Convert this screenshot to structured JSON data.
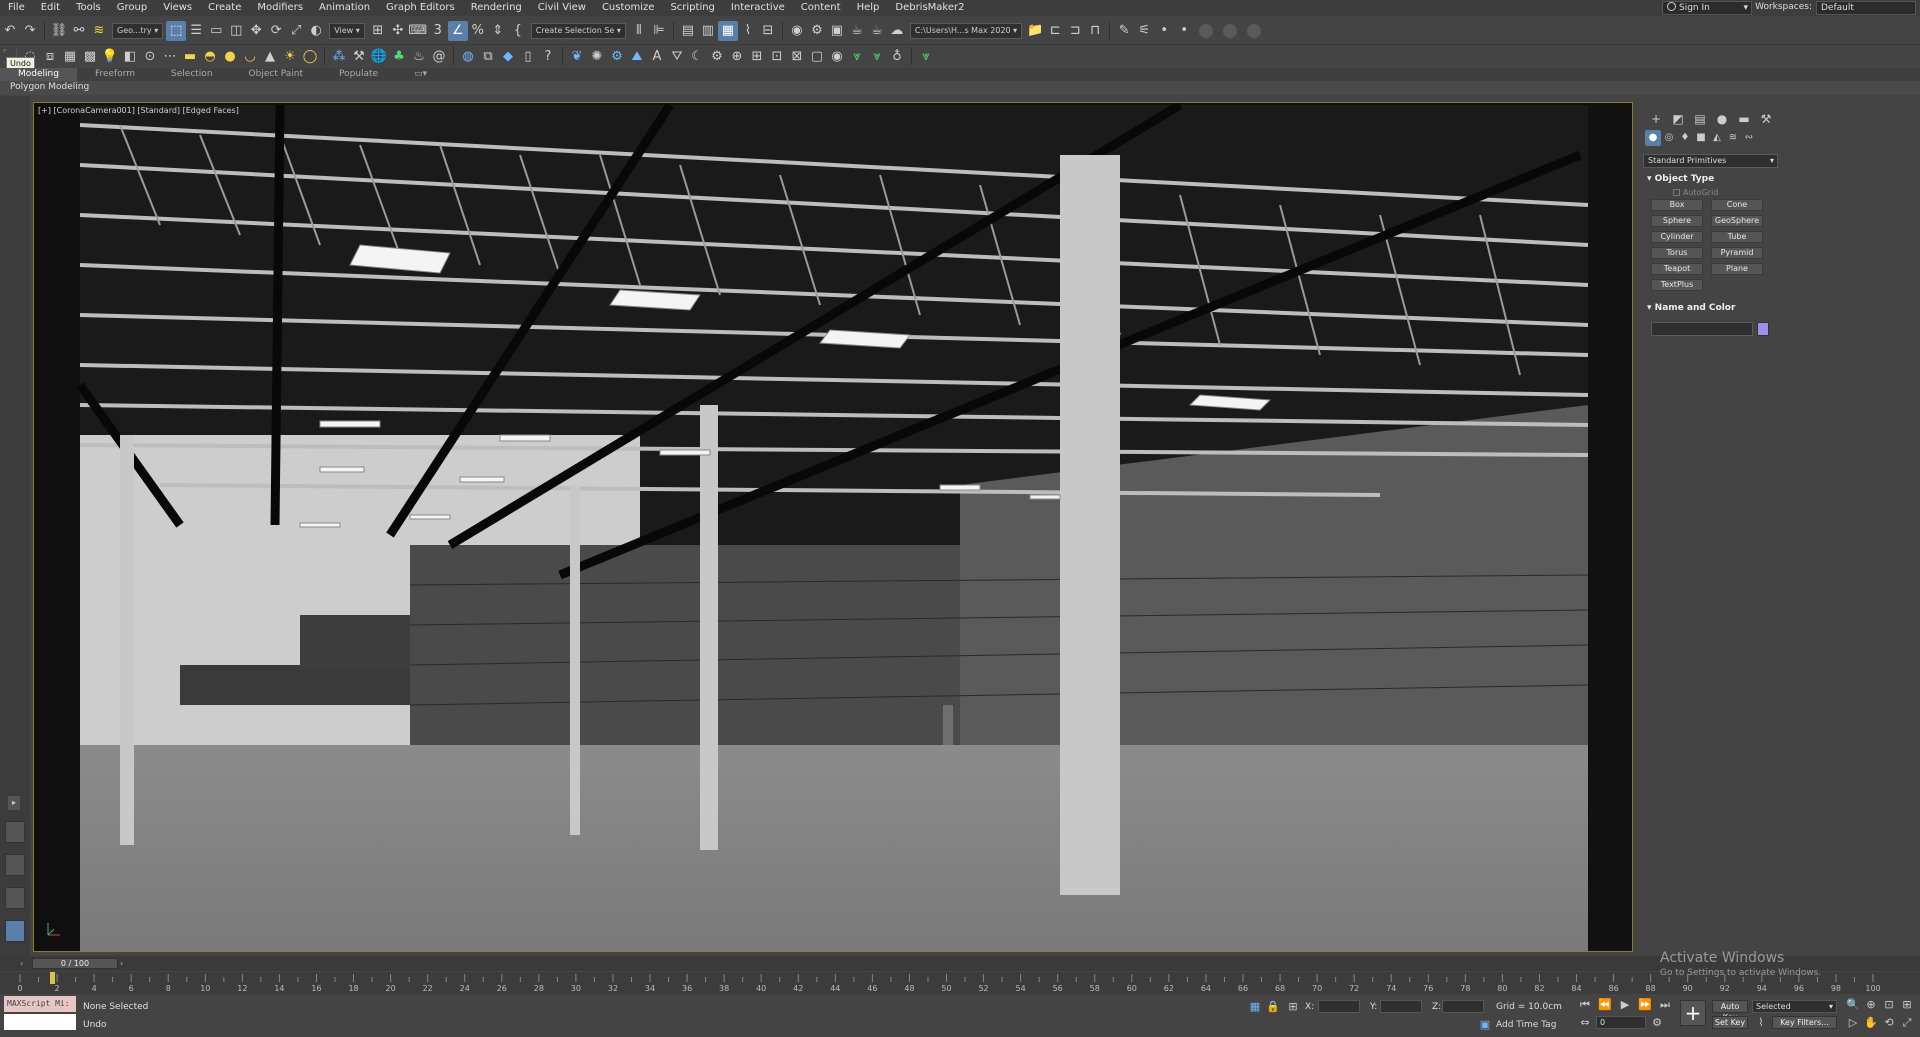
{
  "menu": [
    "File",
    "Edit",
    "Tools",
    "Group",
    "Views",
    "Create",
    "Modifiers",
    "Animation",
    "Graph Editors",
    "Rendering",
    "Civil View",
    "Customize",
    "Scripting",
    "Interactive",
    "Content",
    "Help",
    "DebrisMaker2"
  ],
  "account": {
    "sign_in": "Sign In",
    "workspaces_label": "Workspaces:",
    "workspace_value": "Default"
  },
  "toolbar": {
    "selection_filter": "Geo...try",
    "ref_coord": "View",
    "named_selection": "Create Selection Se",
    "project_path": "C:\\Users\\H...s Max 2020",
    "undo_tooltip": "Undo"
  },
  "ribbon": {
    "tabs": [
      "Modeling",
      "Freeform",
      "Selection",
      "Object Paint",
      "Populate"
    ],
    "active_tab": "Modeling",
    "sub_label": "Polygon Modeling"
  },
  "viewport": {
    "label": "[+] [CoronaCamera001] [Standard] [Edged Faces]",
    "background": "#0f0f0f",
    "frame_color": "#8c7a2a"
  },
  "command_panel": {
    "primitive_category": "Standard Primitives",
    "object_type_title": "Object Type",
    "autogrid_label": "AutoGrid",
    "primitives": [
      "Box",
      "Cone",
      "Sphere",
      "GeoSphere",
      "Cylinder",
      "Tube",
      "Torus",
      "Pyramid",
      "Teapot",
      "Plane",
      "TextPlus"
    ],
    "name_color_title": "Name and Color",
    "object_color": "#9f8fe8"
  },
  "watermark": {
    "title": "Activate Windows",
    "subtitle": "Go to Settings to activate Windows."
  },
  "timeline": {
    "frame_display": "0 / 100",
    "tick_labels": [
      "0",
      "2",
      "4",
      "6",
      "8",
      "10",
      "12",
      "14",
      "16",
      "18",
      "20",
      "22",
      "24",
      "26",
      "28",
      "30",
      "32",
      "34",
      "36",
      "38",
      "40",
      "42",
      "44",
      "46",
      "48",
      "50",
      "52",
      "54",
      "56",
      "58",
      "60",
      "62",
      "64",
      "66",
      "68",
      "70",
      "72",
      "74",
      "76",
      "78",
      "80",
      "82",
      "84",
      "86",
      "88",
      "90",
      "92",
      "94",
      "96",
      "98",
      "100"
    ]
  },
  "status": {
    "maxscript_label": "MAXScript Mi:",
    "selection_status": "None Selected",
    "prompt": "Undo",
    "x_label": "X:",
    "y_label": "Y:",
    "z_label": "Z:",
    "grid": "Grid = 10.0cm",
    "add_time_tag": "Add Time Tag",
    "auto_key": "Auto Key",
    "set_key": "Set Key",
    "key_mode": "Selected",
    "key_filters": "Key Filters...",
    "current_frame": "0"
  }
}
